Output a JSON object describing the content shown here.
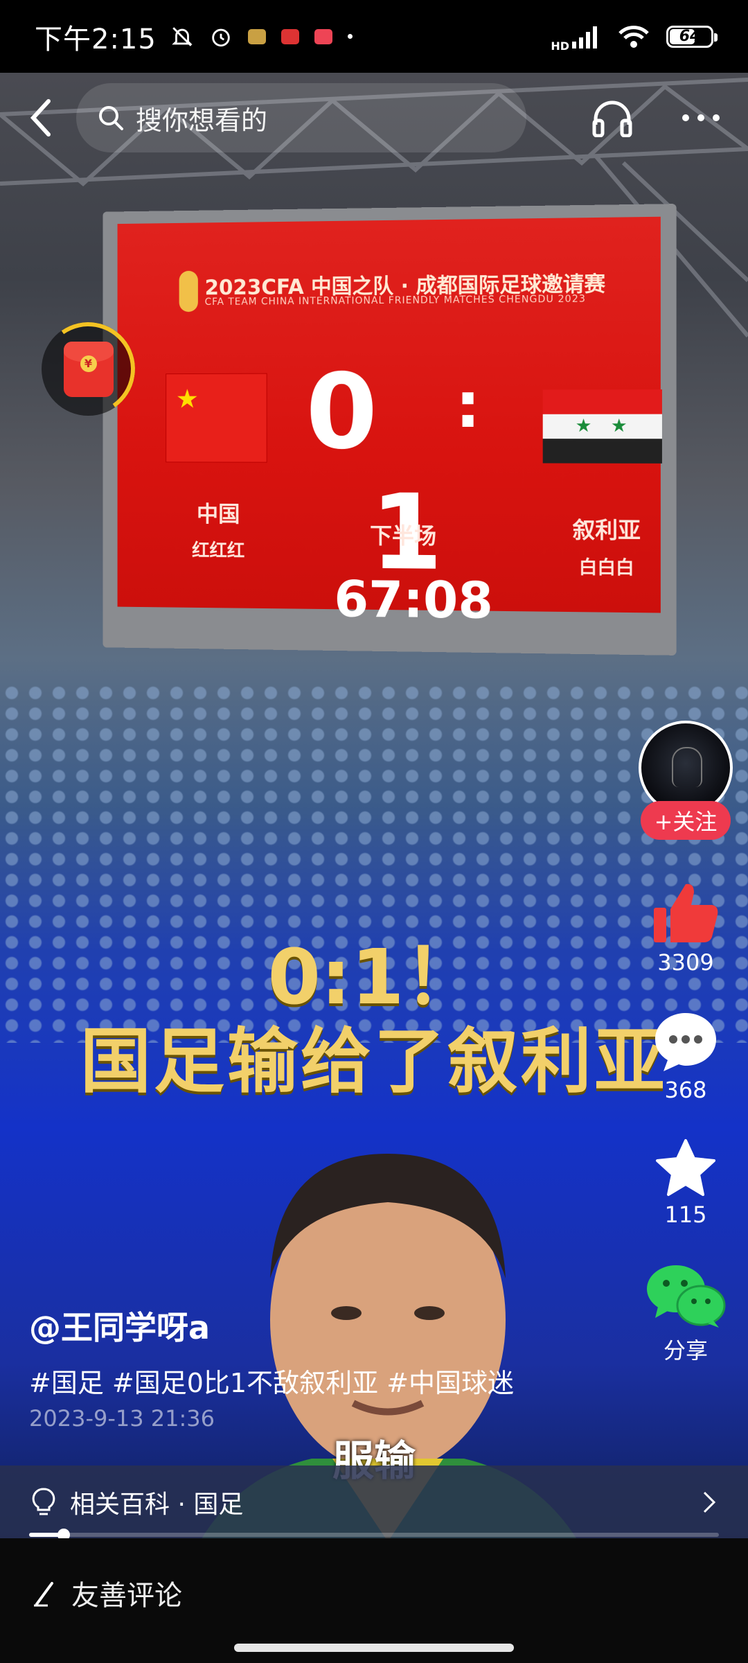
{
  "status_bar": {
    "time": "下午2:15",
    "network": "HD",
    "battery": "64",
    "battery_level": 0.64
  },
  "nav": {
    "search_placeholder": "搜你想看的",
    "back_icon": "back-arrow-icon",
    "audio_icon": "headphones-icon",
    "more_icon": "more-icon"
  },
  "video": {
    "scoreboard_title": "2023CFA 中国之队 · 成都国际足球邀请赛",
    "scoreboard_subtitle": "CFA TEAM CHINA INTERNATIONAL FRIENDLY MATCHES CHENGDU 2023",
    "home_score": "0",
    "separator": ":",
    "away_score": "1",
    "home_team": "中国",
    "home_kit": "红红红",
    "away_team": "叙利亚",
    "away_kit": "白白白",
    "period": "下半场",
    "clock": "67:08",
    "overlay_line1": "0:1！",
    "overlay_line2": "国足输给了叙利亚",
    "subtitle": "服输"
  },
  "rail": {
    "follow_label": "+关注",
    "likes": "3309",
    "comments": "368",
    "favorites": "115",
    "share_label": "分享",
    "accent": "#ee3a4f"
  },
  "post": {
    "author": "@王同学呀a",
    "tags": "#国足 #国足0比1不敌叙利亚 #中国球迷",
    "date": "2023-9-13 21:36"
  },
  "related": {
    "text": "相关百科 · 国足"
  },
  "playback": {
    "progress": 0.05
  },
  "comment_bar": {
    "placeholder": "友善评论"
  }
}
